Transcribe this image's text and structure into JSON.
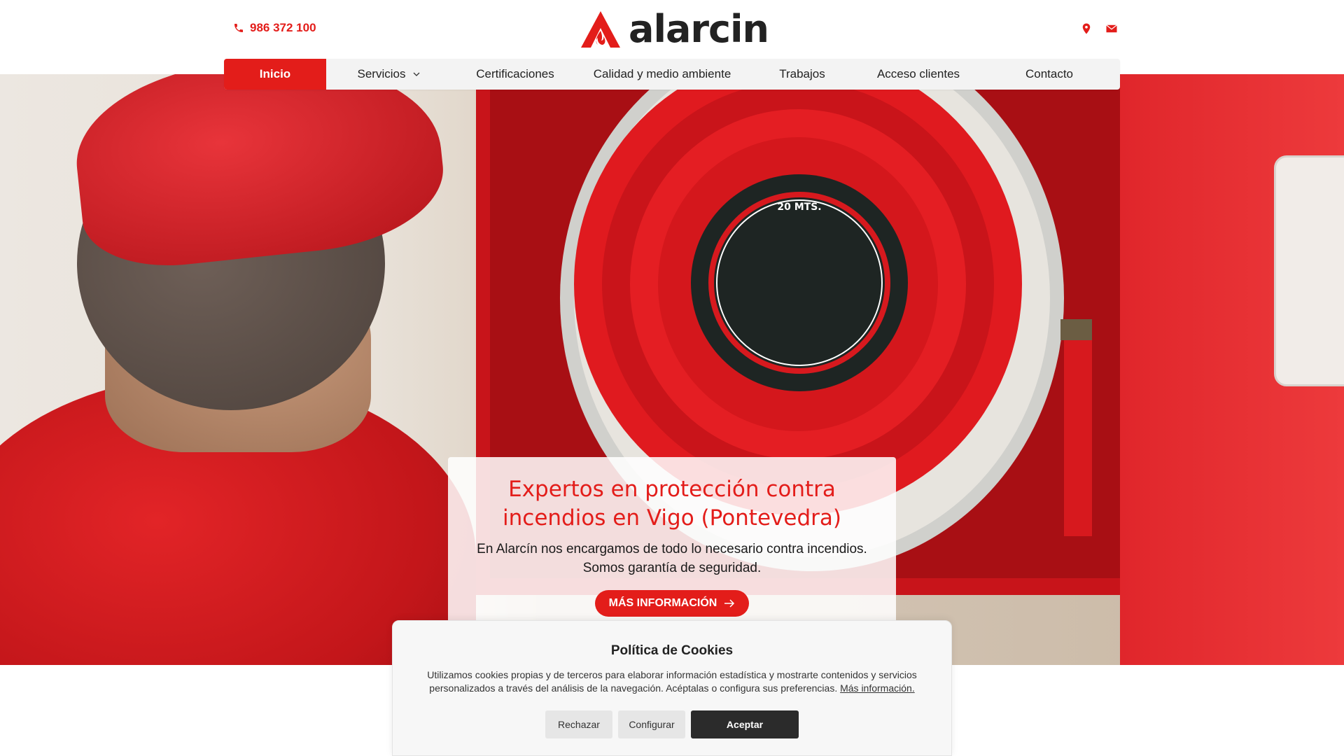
{
  "header": {
    "phone": "986 372 100",
    "logo_text": "alarcin"
  },
  "nav": {
    "items": [
      {
        "label": "Inicio"
      },
      {
        "label": "Servicios"
      },
      {
        "label": "Certificaciones"
      },
      {
        "label": "Calidad y medio ambiente"
      },
      {
        "label": "Trabajos"
      },
      {
        "label": "Acceso clientes"
      },
      {
        "label": "Contacto"
      }
    ]
  },
  "hero": {
    "title": "Expertos en protección contra incendios en Vigo (Pontevedra)",
    "subtitle_line1": "En Alarcín nos encargamos de todo lo necesario contra incendios.",
    "subtitle_line2": "Somos garantía de seguridad.",
    "button_label": "MÁS INFORMACIÓN",
    "reel_label": "20 MTS."
  },
  "cookie": {
    "title": "Política de Cookies",
    "text": "Utilizamos cookies propias y de terceros para elaborar información estadística y mostrarte contenidos y servicios personalizados a través del análisis de la navegación. Acéptalas o configura sus preferencias.",
    "link": "Más información.",
    "reject_label": "Rechazar",
    "config_label": "Configurar",
    "accept_label": "Aceptar"
  },
  "colors": {
    "brand": "#e31d1a",
    "dark": "#2b2b2b"
  }
}
